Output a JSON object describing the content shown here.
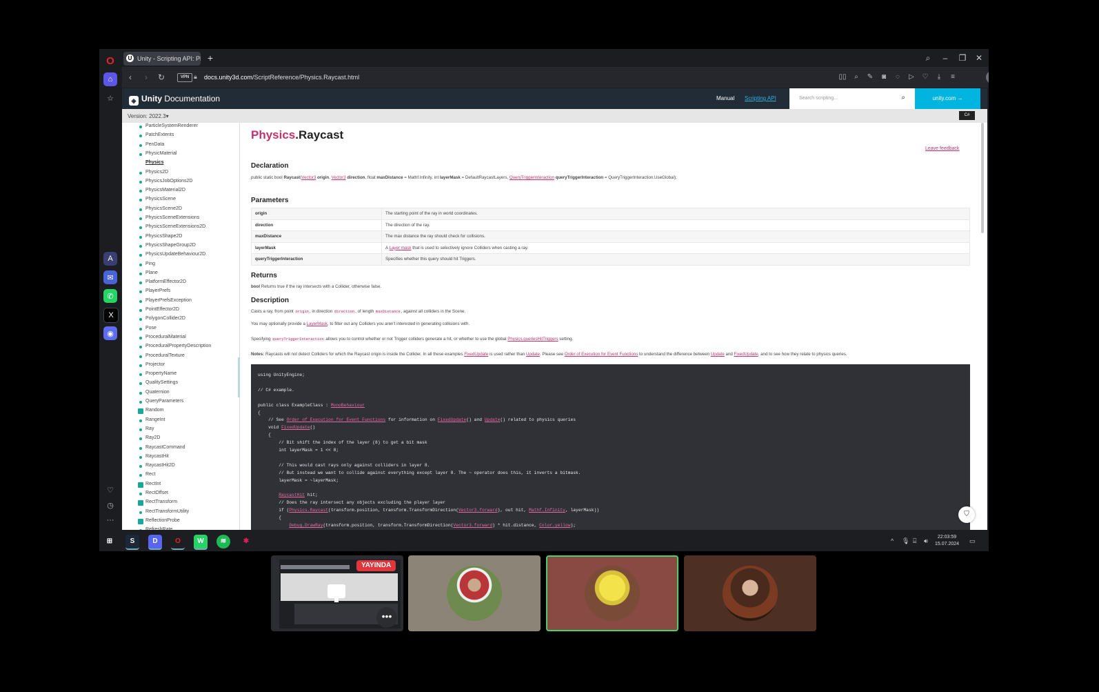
{
  "browser": {
    "tab_title": "Unity - Scripting API: Phys",
    "new_tab": "+",
    "url_domain": "docs.unity3d.com",
    "url_path": "/ScriptReference/Physics.Raycast.html",
    "vpn_label": "VPN"
  },
  "unity_header": {
    "logo_bold": "Unity",
    "logo_text": "Documentation",
    "nav_manual": "Manual",
    "nav_scripting": "Scripting API",
    "search_placeholder": "Search scripting...",
    "unity_link": "unity.com"
  },
  "version": "Version: 2022.3",
  "lang_button": "C#",
  "sidebar_nav": [
    "ParticleSystemRenderer",
    "PatchExtents",
    "PenData",
    "PhysicMaterial",
    "Physics",
    "Physics2D",
    "PhysicsJobOptions2D",
    "PhysicsMaterial2D",
    "PhysicsScene",
    "PhysicsScene2D",
    "PhysicsSceneExtensions",
    "PhysicsSceneExtensions2D",
    "PhysicsShape2D",
    "PhysicsShapeGroup2D",
    "PhysicsUpdateBehaviour2D",
    "Ping",
    "Plane",
    "PlatformEffector2D",
    "PlayerPrefs",
    "PlayerPrefsException",
    "PointEffector2D",
    "PolygonCollider2D",
    "Pose",
    "ProceduralMaterial",
    "ProceduralPropertyDescription",
    "ProceduralTexture",
    "Projector",
    "PropertyName",
    "QualitySettings",
    "Quaternion",
    "QueryParameters",
    "Random",
    "RangeInt",
    "Ray",
    "Ray2D",
    "RaycastCommand",
    "RaycastHit",
    "RaycastHit2D",
    "Rect",
    "RectInt",
    "RectOffset",
    "RectTransform",
    "RectTransformUtility",
    "ReflectionProbe",
    "RefreshRate"
  ],
  "doc": {
    "title_class": "Physics",
    "title_method": ".Raycast",
    "leave_feedback": "Leave feedback",
    "declaration_heading": "Declaration",
    "declaration": {
      "prefix": "public static bool ",
      "name": "Raycast",
      "t1": "Vector3",
      "p1": " origin",
      "t2": "Vector3",
      "p2": " direction",
      "mid": ", float ",
      "p3": "maxDistance",
      "mid2": " = Mathf.Infinity, int ",
      "p4": "layerMask",
      "mid3": " = DefaultRaycastLayers, ",
      "t5": "QueryTriggerInteraction",
      "p5": "queryTriggerInteraction",
      "end": " = QueryTriggerInteraction.UseGlobal);"
    },
    "parameters_heading": "Parameters",
    "parameters": [
      {
        "name": "origin",
        "desc": "The starting point of the ray in world coordinates."
      },
      {
        "name": "direction",
        "desc": "The direction of the ray."
      },
      {
        "name": "maxDistance",
        "desc": "The max distance the ray should check for collisions."
      },
      {
        "name": "layerMask",
        "desc_pre": "A ",
        "desc_link": "Layer mask",
        "desc_post": " that is used to selectively ignore Colliders when casting a ray."
      },
      {
        "name": "queryTriggerInteraction",
        "desc": "Specifies whether this query should hit Triggers."
      }
    ],
    "returns_heading": "Returns",
    "returns_type": "bool",
    "returns_text": " Returns true if the ray intersects with a Collider, otherwise false.",
    "description_heading": "Description",
    "desc1": {
      "a": "Casts a ray, from point ",
      "c1": "origin",
      "b": ", in direction ",
      "c2": "direction",
      "c": ", of length ",
      "c3": "maxDistance",
      "d": ", against all colliders in the Scene."
    },
    "desc2": {
      "a": "You may optionally provide a ",
      "l": "LayerMask",
      "b": ", to filter out any Colliders you aren't interested in generating collisions with."
    },
    "desc3": {
      "a": "Specifying ",
      "c": "queryTriggerInteraction",
      "b": " allows you to control whether or not Trigger colliders generate a hit, or whether to use the global ",
      "l": "Physics.queriesHitTriggers",
      "d": " setting."
    },
    "notes": {
      "label": "Notes:",
      "a": " Raycasts will not detect Colliders for which the Raycast origin is inside the Collider. In all these examples ",
      "l1": "FixedUpdate",
      "b": " is used rather than ",
      "l2": "Update",
      "c": ". Please see ",
      "l3": "Order of Execution for Event Functions",
      "d": " to understand the difference between ",
      "l4": "Update",
      "e": " and ",
      "l5": "FixedUpdate",
      "f": ", and to see how they relate to physics queries."
    },
    "code": [
      "using UnityEngine;",
      "",
      "// C# example.",
      "",
      "public class ExampleClass : |MonoBehaviour|",
      "{",
      "    // See |Order of Execution for Event Functions| for information on |FixedUpdate|() and |Update|() related to physics queries",
      "    void |FixedUpdate|()",
      "    {",
      "        // Bit shift the index of the layer (8) to get a bit mask",
      "        int layerMask = 1 << 8;",
      "",
      "        // This would cast rays only against colliders in layer 8.",
      "        // But instead we want to collide against everything except layer 8. The ~ operator does this, it inverts a bitmask.",
      "        layerMask = ~layerMask;",
      "",
      "        |RaycastHit| hit;",
      "        // Does the ray intersect any objects excluding the player layer",
      "        if (|Physics.Raycast|(transform.position, transform.TransformDirection(|Vector3.forward|), out hit, |Mathf.Infinity|, layerMask))",
      "        {",
      "            |Debug.DrawRay|(transform.position, transform.TransformDirection(|Vector3.forward|) * hit.distance, |Color.yellow|);"
    ]
  },
  "taskbar": {
    "time": "22:03:59",
    "date": "15.07.2024"
  },
  "call": {
    "live_label": "YAYINDA",
    "more": "•••"
  },
  "colors": {
    "accent": "#c4316e",
    "unity_header": "#222c37",
    "unity_cyan": "#00b4e0",
    "active_tile_border": "#4ad26b"
  }
}
